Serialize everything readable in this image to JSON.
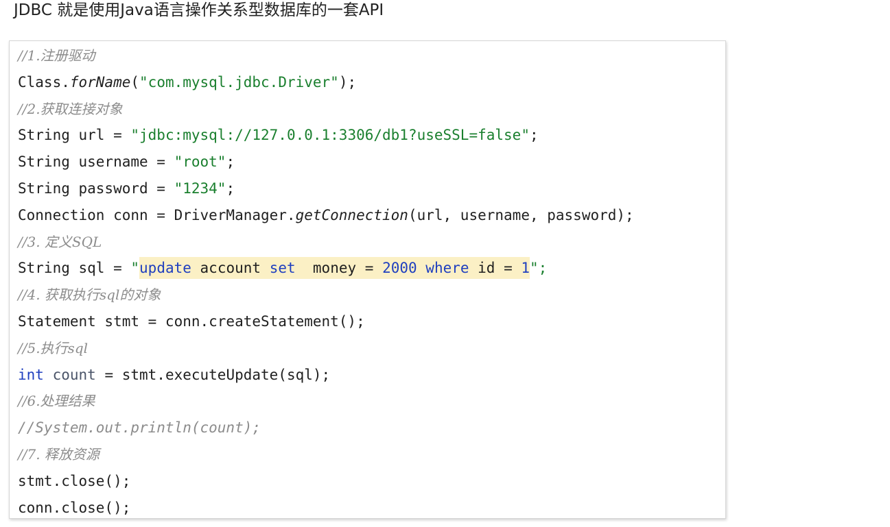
{
  "slide": {
    "title": "JDBC 就是使用Java语言操作关系型数据库的一套API"
  },
  "code": {
    "comment_1": "//1.注册驱动",
    "class_prefix": "Class.",
    "forname_method": "forName",
    "open_paren": "(",
    "driver_string": "\"com.mysql.jdbc.Driver\"",
    "close_paren_semi": ");",
    "comment_2": "//2.获取连接对象",
    "url_decl": "String url = ",
    "url_value": "\"jdbc:mysql://127.0.0.1:3306/db1?useSSL=false\"",
    "semicolon": ";",
    "username_decl": "String username = ",
    "username_value": "\"root\"",
    "password_decl": "String password = ",
    "password_value": "\"1234\"",
    "conn_decl": "Connection conn = DriverManager.",
    "getconnection_method": "getConnection",
    "conn_args": "(url, username, password);",
    "comment_3": "//3. 定义SQL",
    "sql_decl": "String sql = ",
    "sql_open_quote": "\"",
    "sql_update": "update",
    "sql_account": " account ",
    "sql_set": "set",
    "sql_money": "  money = ",
    "sql_2000": "2000",
    "sql_space": " ",
    "sql_where": "where",
    "sql_id": " id = ",
    "sql_1": "1",
    "sql_close": "\";",
    "comment_4": "//4. 获取执行sql的对象",
    "stmt_line": "Statement stmt = conn.createStatement();",
    "comment_5": "//5.执行sql",
    "int_keyword": "int",
    "count_var": " count",
    "execute_rest": " = stmt.executeUpdate(sql);",
    "comment_6": "//6.处理结果",
    "println_comment": "//System.out.println(count);",
    "comment_7": "//7. 释放资源",
    "stmt_close": "stmt.close();",
    "conn_close": "conn.close();"
  },
  "colors": {
    "string": "#1a7f2e",
    "keyword": "#1f3fbf",
    "comment": "#8c8c8c",
    "highlight": "#fbf0c5"
  }
}
